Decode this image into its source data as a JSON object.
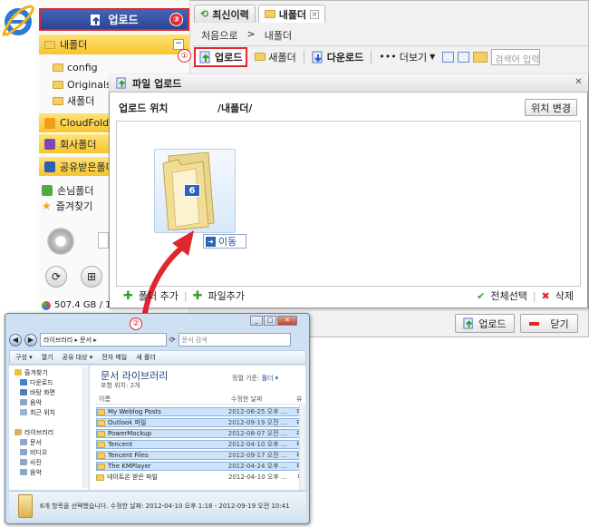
{
  "sidebar": {
    "upload_label": "업로드",
    "step3": "③",
    "my_folder": "내폴더",
    "collapse": "−",
    "tree": [
      "config",
      "Originals",
      "새폴더"
    ],
    "cloud_folder": "CloudFolde",
    "company_folder": "회사폴더",
    "shared_folder": "공유받은폴더",
    "guest_folder": "손님폴더",
    "favorites": "즐겨찾기",
    "storage": "507.4 GB / 1"
  },
  "tabs": [
    {
      "label": "최신이력"
    },
    {
      "label": "내폴더"
    }
  ],
  "breadcrumb": {
    "root": "처음으로",
    "sep": ">",
    "current": "내폴더"
  },
  "toolbar": {
    "step1": "①",
    "upload": "업로드",
    "new_folder": "새폴더",
    "download": "다운로드",
    "more": "더보기",
    "search_placeholder": "검색어 입력"
  },
  "dialog": {
    "title": "파일 업로드",
    "location_label": "업로드 위치",
    "location_path": "/내폴더/",
    "change_location": "위치 변경",
    "file_count": "6",
    "move_label": "이동",
    "add_folder": "폴더 추가",
    "add_file": "파일추가",
    "select_all": "전체선택",
    "delete": "삭제",
    "upload_button": "업로드",
    "close_button": "닫기"
  },
  "explorer": {
    "step2": "②",
    "address": "라이브러리 ▸ 문서 ▸",
    "search_placeholder": "문서 검색",
    "commands": [
      "구성 ▾",
      "열기",
      "공유 대상 ▾",
      "전자 메일",
      "새 폴더"
    ],
    "nav_items": [
      {
        "label": "즐겨찾기",
        "color": "#f2c230"
      },
      {
        "label": "다운로드",
        "color": "#3e86d1"
      },
      {
        "label": "바탕 화면",
        "color": "#4a7fc1"
      },
      {
        "label": "음악",
        "color": "#8aa7c9"
      },
      {
        "label": "최근 위치",
        "color": "#9bb5cf"
      },
      {
        "label": "",
        "color": ""
      },
      {
        "label": "라이브러리",
        "color": "#d7b35a"
      },
      {
        "label": "문서",
        "color": "#8aa7c9"
      },
      {
        "label": "비디오",
        "color": "#8aa7c9"
      },
      {
        "label": "사진",
        "color": "#8aa7c9"
      },
      {
        "label": "음악",
        "color": "#8aa7c9"
      }
    ],
    "library_title": "문서 라이브러리",
    "library_sub": "포함 위치: 2개",
    "sort_label": "정렬 기준:",
    "sort_value": "폴더 ▾",
    "col_name": "이름",
    "col_date": "수정한 날짜",
    "col_type": "유",
    "files": [
      {
        "name": "My Weblog Posts",
        "date": "2012-06-25 오후 ...",
        "type": "파",
        "selected": true
      },
      {
        "name": "Outlook 파일",
        "date": "2012-09-19 오전 ...",
        "type": "파",
        "selected": true
      },
      {
        "name": "PowerMockup",
        "date": "2012-08-07 오전 ...",
        "type": "파",
        "selected": true
      },
      {
        "name": "Tencent",
        "date": "2012-04-10 오후 ...",
        "type": "파",
        "selected": true
      },
      {
        "name": "Tencent Files",
        "date": "2012-09-17 오전 ...",
        "type": "파",
        "selected": true
      },
      {
        "name": "The KMPlayer",
        "date": "2012-04-24 오후 ...",
        "type": "파",
        "selected": true
      },
      {
        "name": "네이트온 받은 파일",
        "date": "2012-04-10 오후 ...",
        "type": "파",
        "selected": false
      }
    ],
    "status": "6개 항목을 선택했습니다. 수정한 날짜: 2012-04-10 오후 1:18 - 2012-09-19 오전 10:41"
  },
  "colors": {
    "accent_red": "#e0262f",
    "header_blue": "#2b4595",
    "folder_yellow": "#f7c62c"
  }
}
